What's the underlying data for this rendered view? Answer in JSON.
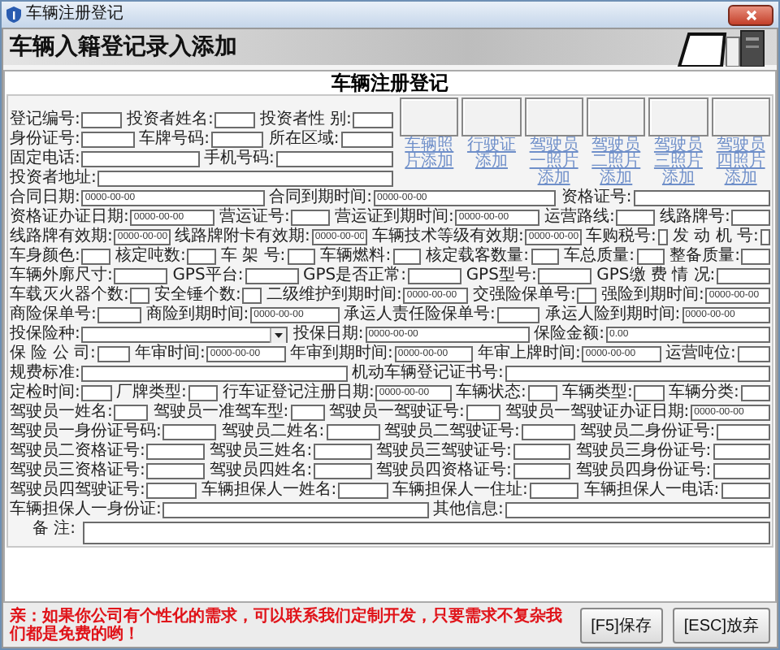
{
  "window": {
    "title": "车辆注册登记"
  },
  "header": {
    "title": "车辆入籍登记录入添加"
  },
  "form": {
    "heading": "车辆注册登记",
    "top_lines": [
      {
        "fields": [
          {
            "label": "登记编号:",
            "kind": "text"
          },
          {
            "label": "投资者姓名:",
            "kind": "text"
          },
          {
            "label": "投资者性 别:",
            "kind": "text"
          }
        ]
      },
      {
        "fields": [
          {
            "label": "身份证号:",
            "kind": "text"
          },
          {
            "label": "车牌号码:",
            "kind": "text"
          },
          {
            "label": "所在区域:",
            "kind": "text"
          }
        ]
      },
      {
        "fields": [
          {
            "label": "固定电话:",
            "kind": "text"
          },
          {
            "label": "手机号码:",
            "kind": "text"
          }
        ]
      },
      {
        "fields": [
          {
            "label": "投资者地址:",
            "kind": "text"
          }
        ]
      }
    ],
    "photos": [
      {
        "link": "车辆照片添加"
      },
      {
        "link": "行驶证添加"
      },
      {
        "link": "驾驶员一照片添加"
      },
      {
        "link": "驾驶员二照片添加"
      },
      {
        "link": "驾驶员三照片添加"
      },
      {
        "link": "驾驶员四照片添加"
      }
    ],
    "lines": [
      {
        "fields": [
          {
            "label": "合同日期:",
            "kind": "text",
            "value": "0000-00-00"
          },
          {
            "label": "合同到期时间:",
            "kind": "text",
            "value": "0000-00-00"
          },
          {
            "label": "资格证号:",
            "kind": "text"
          }
        ]
      },
      {
        "fields": [
          {
            "label": "资格证办证日期:",
            "kind": "text",
            "value": "0000-00-00"
          },
          {
            "label": "营运证号:",
            "kind": "text"
          },
          {
            "label": "营运证到期时间:",
            "kind": "text",
            "value": "0000-00-00"
          },
          {
            "label": "运营路线:",
            "kind": "text"
          },
          {
            "label": "线路牌号:",
            "kind": "text"
          }
        ]
      },
      {
        "fields": [
          {
            "label": "线路牌有效期:",
            "kind": "text",
            "value": "0000-00-00"
          },
          {
            "label": "线路牌附卡有效期:",
            "kind": "text",
            "value": "0000-00-00"
          },
          {
            "label": "车辆技术等级有效期:",
            "kind": "text",
            "value": "0000-00-00"
          },
          {
            "label": "车购税号:",
            "kind": "text"
          },
          {
            "label": "发 动 机 号:",
            "kind": "text"
          }
        ]
      },
      {
        "fields": [
          {
            "label": "车身颜色:",
            "kind": "text"
          },
          {
            "label": "核定吨数:",
            "kind": "text"
          },
          {
            "label": "车 架 号:",
            "kind": "text"
          },
          {
            "label": "车辆燃料:",
            "kind": "text"
          },
          {
            "label": "核定载客数量:",
            "kind": "text"
          },
          {
            "label": "车总质量:",
            "kind": "text"
          },
          {
            "label": "整备质量:",
            "kind": "text"
          }
        ]
      },
      {
        "fields": [
          {
            "label": "车辆外廓尺寸:",
            "kind": "text"
          },
          {
            "label": "GPS平台:",
            "kind": "text"
          },
          {
            "label": "GPS是否正常:",
            "kind": "text"
          },
          {
            "label": "GPS型号:",
            "kind": "text"
          },
          {
            "label": "GPS缴 费 情 况:",
            "kind": "text"
          }
        ]
      },
      {
        "fields": [
          {
            "label": "车载灭火器个数:",
            "kind": "text"
          },
          {
            "label": "安全锤个数:",
            "kind": "text"
          },
          {
            "label": "二级维护到期时间:",
            "kind": "text",
            "value": "0000-00-00"
          },
          {
            "label": "交强险保单号:",
            "kind": "text"
          },
          {
            "label": "强险到期时间:",
            "kind": "text",
            "value": "0000-00-00"
          }
        ]
      },
      {
        "fields": [
          {
            "label": "商险保单号:",
            "kind": "text"
          },
          {
            "label": "商险到期时间:",
            "kind": "text",
            "value": "0000-00-00"
          },
          {
            "label": "承运人责任险保单号:",
            "kind": "text"
          },
          {
            "label": "承运人险到期时间:",
            "kind": "text",
            "value": "0000-00-00"
          }
        ]
      },
      {
        "fields": [
          {
            "label": "投保险种:",
            "kind": "select"
          },
          {
            "label": "投保日期:",
            "kind": "text",
            "value": "0000-00-00"
          },
          {
            "label": "保险金额:",
            "kind": "text",
            "value": "0.00"
          }
        ]
      },
      {
        "fields": [
          {
            "label": "保 险 公 司:",
            "kind": "text"
          },
          {
            "label": "年审时间:",
            "kind": "text",
            "value": "0000-00-00"
          },
          {
            "label": "年审到期时间:",
            "kind": "text",
            "value": "0000-00-00"
          },
          {
            "label": "年审上牌时间:",
            "kind": "text",
            "value": "0000-00-00"
          },
          {
            "label": "运营吨位:",
            "kind": "text"
          }
        ]
      },
      {
        "fields": [
          {
            "label": "规费标准:",
            "kind": "text"
          },
          {
            "label": "机动车辆登记证书号:",
            "kind": "text"
          }
        ]
      },
      {
        "fields": [
          {
            "label": "定检时间:",
            "kind": "text"
          },
          {
            "label": "厂牌类型:",
            "kind": "text"
          },
          {
            "label": "行车证登记注册日期:",
            "kind": "text",
            "value": "0000-00-00"
          },
          {
            "label": "车辆状态:",
            "kind": "text"
          },
          {
            "label": "车辆类型:",
            "kind": "text"
          },
          {
            "label": "车辆分类:",
            "kind": "text"
          }
        ]
      },
      {
        "fields": [
          {
            "label": "驾驶员一姓名:",
            "kind": "text"
          },
          {
            "label": "驾驶员一准驾车型:",
            "kind": "text"
          },
          {
            "label": "驾驶员一驾驶证号:",
            "kind": "text"
          },
          {
            "label": "驾驶员一驾驶证办证日期:",
            "kind": "text",
            "value": "0000-00-00"
          }
        ]
      },
      {
        "fields": [
          {
            "label": "驾驶员一身份证号码:",
            "kind": "text"
          },
          {
            "label": "驾驶员二姓名:",
            "kind": "text"
          },
          {
            "label": "驾驶员二驾驶证号:",
            "kind": "text"
          },
          {
            "label": "驾驶员二身份证号:",
            "kind": "text"
          }
        ]
      },
      {
        "fields": [
          {
            "label": "驾驶员二资格证号:",
            "kind": "text"
          },
          {
            "label": "驾驶员三姓名:",
            "kind": "text"
          },
          {
            "label": "驾驶员三驾驶证号:",
            "kind": "text"
          },
          {
            "label": "驾驶员三身份证号:",
            "kind": "text"
          }
        ]
      },
      {
        "fields": [
          {
            "label": "驾驶员三资格证号:",
            "kind": "text"
          },
          {
            "label": "驾驶员四姓名:",
            "kind": "text"
          },
          {
            "label": "驾驶员四资格证号:",
            "kind": "text"
          },
          {
            "label": "驾驶员四身份证号:",
            "kind": "text"
          }
        ]
      },
      {
        "fields": [
          {
            "label": "驾驶员四驾驶证号:",
            "kind": "text"
          },
          {
            "label": "车辆担保人一姓名:",
            "kind": "text"
          },
          {
            "label": "车辆担保人一住址:",
            "kind": "text"
          },
          {
            "label": "车辆担保人一电话:",
            "kind": "text"
          }
        ]
      },
      {
        "fields": [
          {
            "label": "车辆担保人一身份证:",
            "kind": "text"
          },
          {
            "label": "其他信息:",
            "kind": "text"
          }
        ]
      }
    ],
    "remarks": {
      "label": "备 注:"
    }
  },
  "notice": "亲：如果你公司有个性化的需求，可以联系我们定制开发，只要需求不复杂我们都是免费的哟！",
  "buttons": [
    "[F5]保存",
    "[ESC]放弃"
  ]
}
